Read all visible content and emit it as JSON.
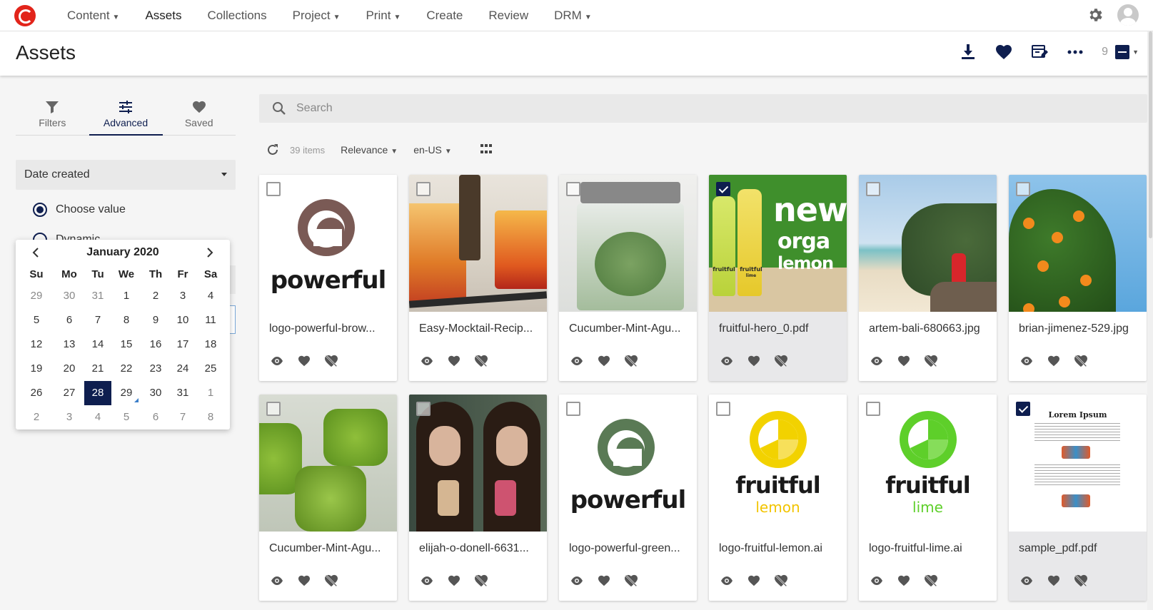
{
  "nav": {
    "items": [
      {
        "label": "Content",
        "dropdown": true
      },
      {
        "label": "Assets",
        "dropdown": false
      },
      {
        "label": "Collections",
        "dropdown": false
      },
      {
        "label": "Project",
        "dropdown": true
      },
      {
        "label": "Print",
        "dropdown": true
      },
      {
        "label": "Create",
        "dropdown": false
      },
      {
        "label": "Review",
        "dropdown": false
      },
      {
        "label": "DRM",
        "dropdown": true
      }
    ]
  },
  "header": {
    "title": "Assets",
    "selection_count": "9"
  },
  "sidebar": {
    "tabs": [
      {
        "label": "Filters",
        "icon": "filter-icon"
      },
      {
        "label": "Advanced",
        "icon": "sliders-icon"
      },
      {
        "label": "Saved",
        "icon": "heart-icon"
      }
    ],
    "field": "Date created",
    "radio_choose": "Choose value",
    "radio_dynamic": "Dynamic"
  },
  "calendar": {
    "title": "January 2020",
    "weekdays": [
      "Su",
      "Mo",
      "Tu",
      "We",
      "Th",
      "Fr",
      "Sa"
    ],
    "days": [
      [
        "29",
        "30",
        "31",
        "1",
        "2",
        "3",
        "4"
      ],
      [
        "5",
        "6",
        "7",
        "8",
        "9",
        "10",
        "11"
      ],
      [
        "12",
        "13",
        "14",
        "15",
        "16",
        "17",
        "18"
      ],
      [
        "19",
        "20",
        "21",
        "22",
        "23",
        "24",
        "25"
      ],
      [
        "26",
        "27",
        "28",
        "29",
        "30",
        "31",
        "1"
      ],
      [
        "2",
        "3",
        "4",
        "5",
        "6",
        "7",
        "8"
      ]
    ],
    "selected": "28",
    "today": "29"
  },
  "search": {
    "placeholder": "Search"
  },
  "toolbar": {
    "items_count": "39 items",
    "sort": "Relevance",
    "locale": "en-US"
  },
  "assets": [
    {
      "name": "logo-powerful-brow...",
      "checked": false
    },
    {
      "name": "Easy-Mocktail-Recip...",
      "checked": false
    },
    {
      "name": "Cucumber-Mint-Agu...",
      "checked": false
    },
    {
      "name": "fruitful-hero_0.pdf",
      "checked": true
    },
    {
      "name": "artem-bali-680663.jpg",
      "checked": false
    },
    {
      "name": "brian-jimenez-529.jpg",
      "checked": false
    },
    {
      "name": "Cucumber-Mint-Agu...",
      "checked": false
    },
    {
      "name": "elijah-o-donell-6631...",
      "checked": false
    },
    {
      "name": "logo-powerful-green...",
      "checked": false
    },
    {
      "name": "logo-fruitful-lemon.ai",
      "checked": false
    },
    {
      "name": "logo-fruitful-lime.ai",
      "checked": false
    },
    {
      "name": "sample_pdf.pdf",
      "checked": true
    }
  ],
  "thumb_text": {
    "powerful": "powerful",
    "fruitful": "fruitful",
    "lemon": "lemon",
    "lime": "lime",
    "hero_new": "new",
    "hero_orga": "orga",
    "hero_lemon": "lemon",
    "bottle_label": "fruitful",
    "bottle_sub": "lime",
    "pdf_title": "Lorem Ipsum"
  },
  "colors": {
    "brand_red": "#e2241a",
    "navy": "#0e1e4f",
    "brown": "#7a5a55",
    "green_logo": "#5a7a55",
    "lemon": "#f2d200",
    "lime": "#5ecf2a"
  }
}
